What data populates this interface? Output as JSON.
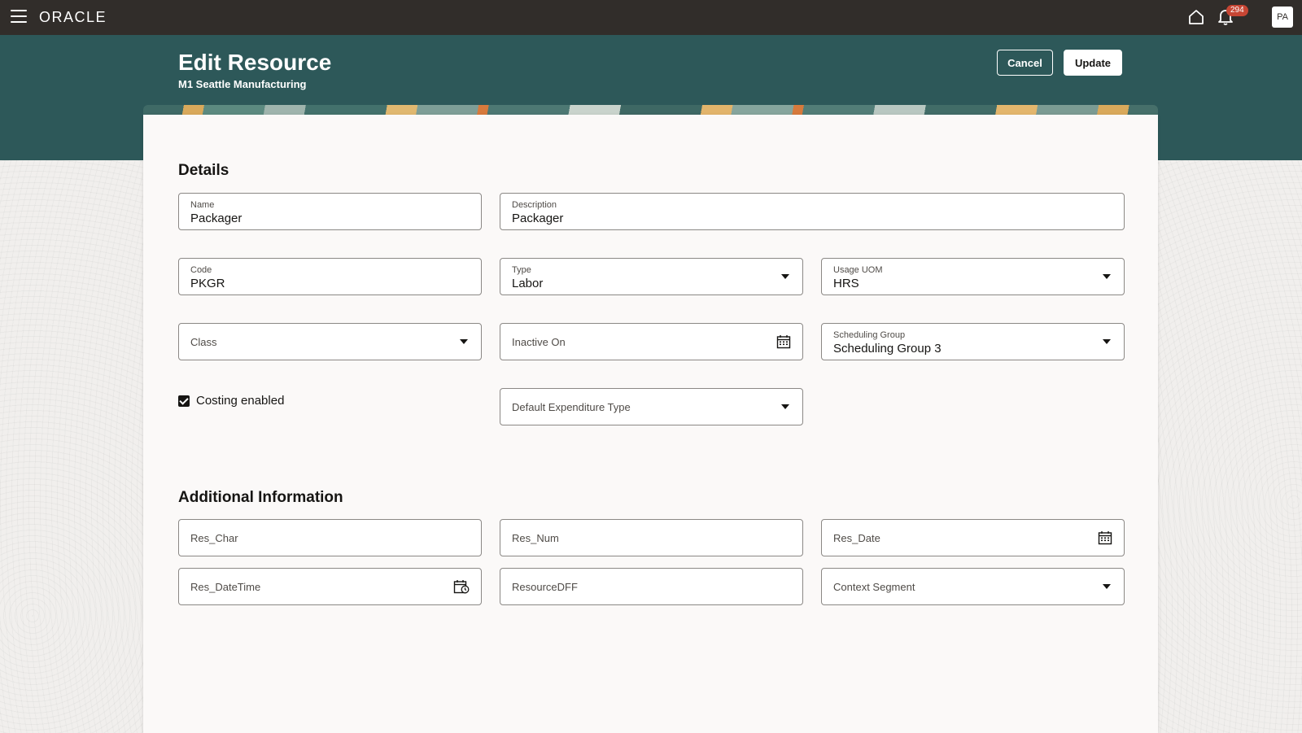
{
  "topbar": {
    "logo": "ORACLE",
    "notification_count": "294",
    "avatar_initials": "PA"
  },
  "header": {
    "title": "Edit Resource",
    "subtitle": "M1 Seattle Manufacturing",
    "cancel_label": "Cancel",
    "update_label": "Update"
  },
  "details": {
    "section_title": "Details",
    "name": {
      "label": "Name",
      "value": "Packager"
    },
    "description": {
      "label": "Description",
      "value": "Packager"
    },
    "code": {
      "label": "Code",
      "value": "PKGR"
    },
    "type": {
      "label": "Type",
      "value": "Labor"
    },
    "usage_uom": {
      "label": "Usage UOM",
      "value": "HRS"
    },
    "class": {
      "placeholder": "Class"
    },
    "inactive_on": {
      "placeholder": "Inactive On"
    },
    "scheduling_group": {
      "label": "Scheduling Group",
      "value": "Scheduling Group 3"
    },
    "costing_enabled": {
      "label": "Costing enabled",
      "checked": true
    },
    "default_expenditure_type": {
      "placeholder": "Default Expenditure Type"
    }
  },
  "additional": {
    "section_title": "Additional Information",
    "res_char": "Res_Char",
    "res_num": "Res_Num",
    "res_date": "Res_Date",
    "res_datetime": "Res_DateTime",
    "resource_dff": "ResourceDFF",
    "context_segment": "Context Segment"
  },
  "colors": {
    "topbar": "#312d2a",
    "header_band": "#2d5859",
    "badge": "#c74634"
  }
}
